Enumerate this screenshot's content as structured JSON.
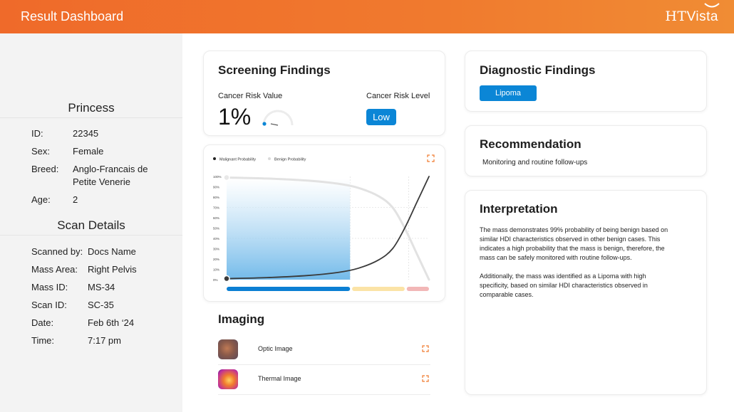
{
  "header": {
    "title": "Result Dashboard",
    "logo_ht": "HT",
    "logo_vista": "Vista"
  },
  "patient": {
    "name": "Princess",
    "fields": [
      {
        "label": "ID:",
        "value": "22345"
      },
      {
        "label": "Sex:",
        "value": "Female"
      },
      {
        "label": "Breed:",
        "value": "Anglo-Francais de",
        "value2": "Petite Venerie"
      },
      {
        "label": "Age:",
        "value": "2"
      }
    ]
  },
  "scan": {
    "title": "Scan Details",
    "fields": [
      {
        "label": "Scanned by:",
        "value": "Docs Name"
      },
      {
        "label": "Mass Area:",
        "value": "Right Pelvis"
      },
      {
        "label": "Mass ID:",
        "value": "MS-34"
      },
      {
        "label": "Scan ID:",
        "value": "SC-35"
      },
      {
        "label": "Date:",
        "value": "Feb 6th ‘24"
      },
      {
        "label": "Time:",
        "value": "7:17 pm"
      }
    ]
  },
  "screening": {
    "title": "Screening Findings",
    "risk_value_label": "Cancer Risk Value",
    "risk_value": "1%",
    "risk_value_fraction": 0.01,
    "risk_level_label": "Cancer Risk Level",
    "risk_level": "Low"
  },
  "chart_data": {
    "type": "line",
    "legend": [
      "Malignant Probability",
      "Benign Probability"
    ],
    "legend_placement": "top-left",
    "y_ticks": [
      "100%",
      "90%",
      "80%",
      "70%",
      "60%",
      "50%",
      "40%",
      "30%",
      "20%",
      "10%",
      "0%"
    ],
    "ylim": [
      0,
      100
    ],
    "xlim": [
      0,
      100
    ],
    "grid": true,
    "series": [
      {
        "name": "Malignant Probability",
        "x": [
          0,
          20,
          40,
          55,
          65,
          75,
          82,
          88,
          94,
          100
        ],
        "values": [
          1,
          2,
          4,
          7,
          11,
          19,
          30,
          50,
          75,
          100
        ]
      },
      {
        "name": "Benign Probability",
        "x": [
          0,
          20,
          40,
          55,
          65,
          75,
          82,
          88,
          94,
          100
        ],
        "values": [
          99,
          98,
          96,
          93,
          89,
          81,
          70,
          50,
          25,
          0
        ]
      }
    ],
    "marker_x": 0,
    "highlight_x_range": [
      0,
      61
    ],
    "zones": [
      {
        "x_range": [
          0,
          61
        ],
        "color": "#0b7fd3"
      },
      {
        "x_range": [
          62,
          88
        ],
        "color": "#fbe3a6"
      },
      {
        "x_range": [
          89,
          100
        ],
        "color": "#f2b7b7"
      }
    ]
  },
  "imaging": {
    "title": "Imaging",
    "items": [
      {
        "label": "Optic Image",
        "icon": "expand-icon"
      },
      {
        "label": "Thermal Image",
        "icon": "expand-icon"
      }
    ]
  },
  "diagnostic": {
    "title": "Diagnostic Findings",
    "tag": "Lipoma"
  },
  "recommendation": {
    "title": "Recommendation",
    "text": "Monitoring and routine follow-ups"
  },
  "interpretation": {
    "title": "Interpretation",
    "p1": [
      "The mass demonstrates 99% probability of being benign based on",
      "similar HDI characteristics observed in other benign cases. This",
      "indicates a high probability that the mass is benign, therefore, the",
      "mass can be safely monitored with routine follow-ups."
    ],
    "p2": [
      "Additionally, the mass was identified as a Lipoma with high",
      "specificity, based on similar HDI characteristics observed in",
      "comparable cases."
    ]
  },
  "colors": {
    "accent": "#ef6a2a",
    "primary": "#0b86d6",
    "sidebar_bg": "#f3f3f3"
  }
}
